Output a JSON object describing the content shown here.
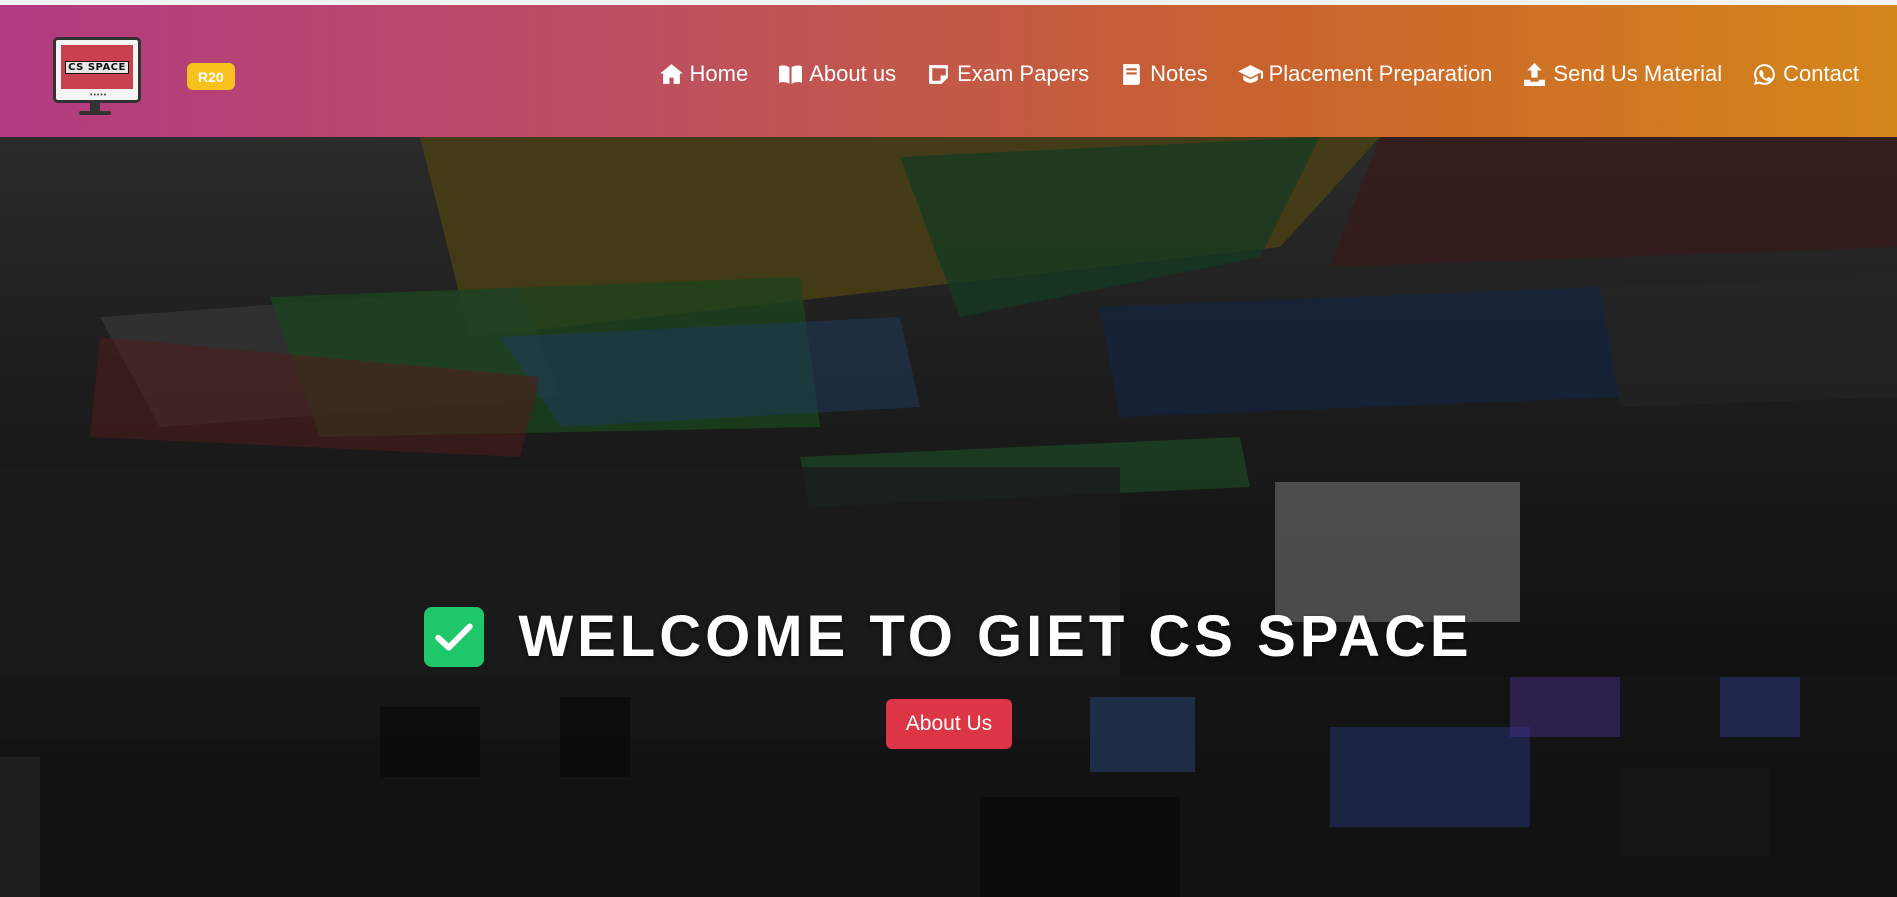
{
  "brand": {
    "logo_text": "CS SPACE",
    "badge": "R20"
  },
  "nav": {
    "items": [
      {
        "label": "Home",
        "icon": "home-icon"
      },
      {
        "label": "About us",
        "icon": "book-open-icon"
      },
      {
        "label": "Exam Papers",
        "icon": "sticky-note-icon"
      },
      {
        "label": "Notes",
        "icon": "book-icon"
      },
      {
        "label": "Placement Preparation",
        "icon": "graduation-cap-icon"
      },
      {
        "label": "Send Us Material",
        "icon": "upload-icon"
      },
      {
        "label": "Contact",
        "icon": "whatsapp-icon"
      }
    ]
  },
  "hero": {
    "title": "WELCOME TO GIET CS SPACE",
    "icon": "check-square-icon",
    "button_label": "About Us"
  },
  "colors": {
    "nav_gradient_start": "#b23a82",
    "nav_gradient_end": "#d5861a",
    "badge": "#f7c21e",
    "check": "#1ec86a",
    "button": "#dc3545"
  }
}
